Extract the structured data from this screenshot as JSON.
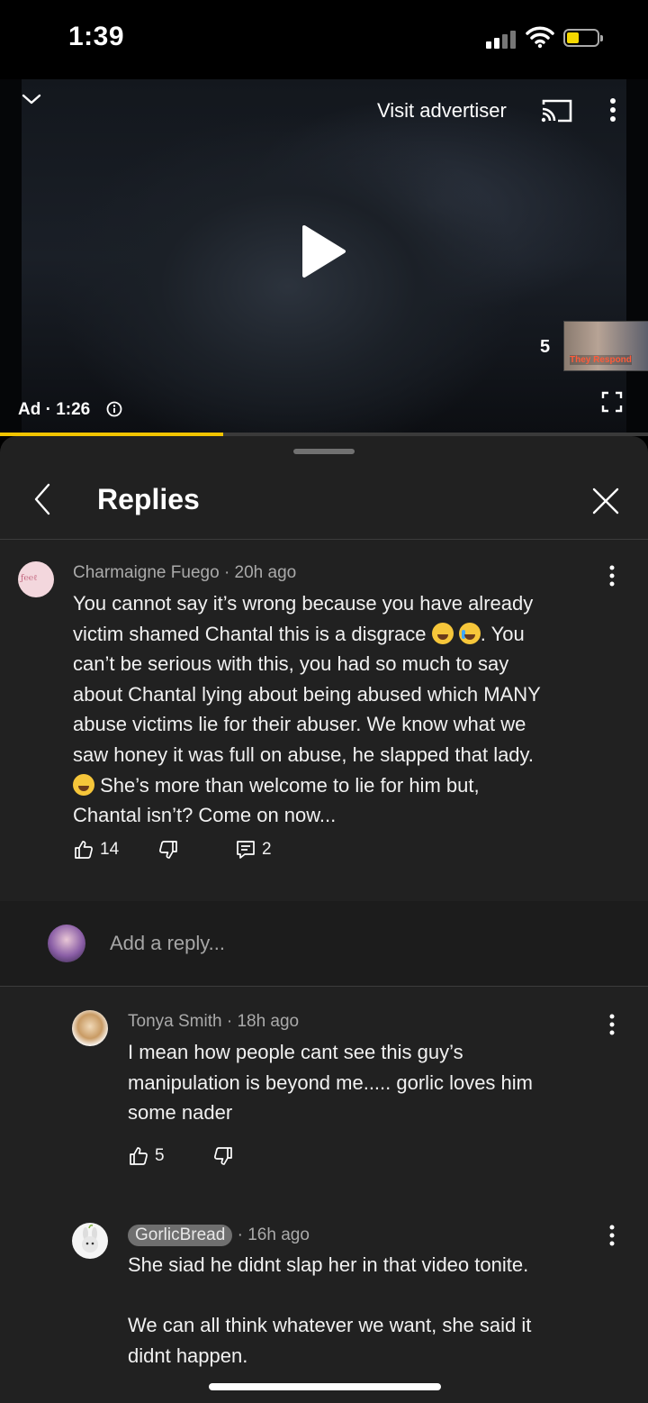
{
  "status_bar": {
    "time": "1:39"
  },
  "video": {
    "visit_advertiser": "Visit advertiser",
    "ad_label": "Ad · 1:26",
    "countdown": "5",
    "thumbnail_text": "They Respond",
    "progress_fraction": 0.345
  },
  "panel": {
    "title": "Replies"
  },
  "parent_comment": {
    "author": "Charmaigne Fuego",
    "time": "20h ago",
    "line1": "You cannot say it’s wrong because you have already",
    "line2a": "victim shamed Chantal this is a disgrace ",
    "line2b": ". You",
    "line3": "can’t be serious with this, you had so much to say",
    "line4": "about Chantal lying about being abused which MANY",
    "line5": "abuse victims lie for their abuser. We know what we",
    "line6": "saw honey it was full on abuse, he slapped that lady.",
    "line7": " She’s more than welcome to lie for him but,",
    "line8": "Chantal isn’t? Come on now...",
    "likes": "14",
    "replies": "2"
  },
  "reply_box": {
    "placeholder": "Add a reply..."
  },
  "replies": [
    {
      "author": "Tonya Smith",
      "time": "18h ago",
      "line1": "I mean how people cant see this guy’s",
      "line2": "manipulation is beyond me..... gorlic loves him",
      "line3": "some nader",
      "likes": "5"
    },
    {
      "author": "GorlicBread",
      "time": "16h ago",
      "line1": "She siad he didnt slap her in that video tonite.",
      "line2": "We can all think whatever we want, she said it",
      "line3": "didnt happen."
    }
  ]
}
